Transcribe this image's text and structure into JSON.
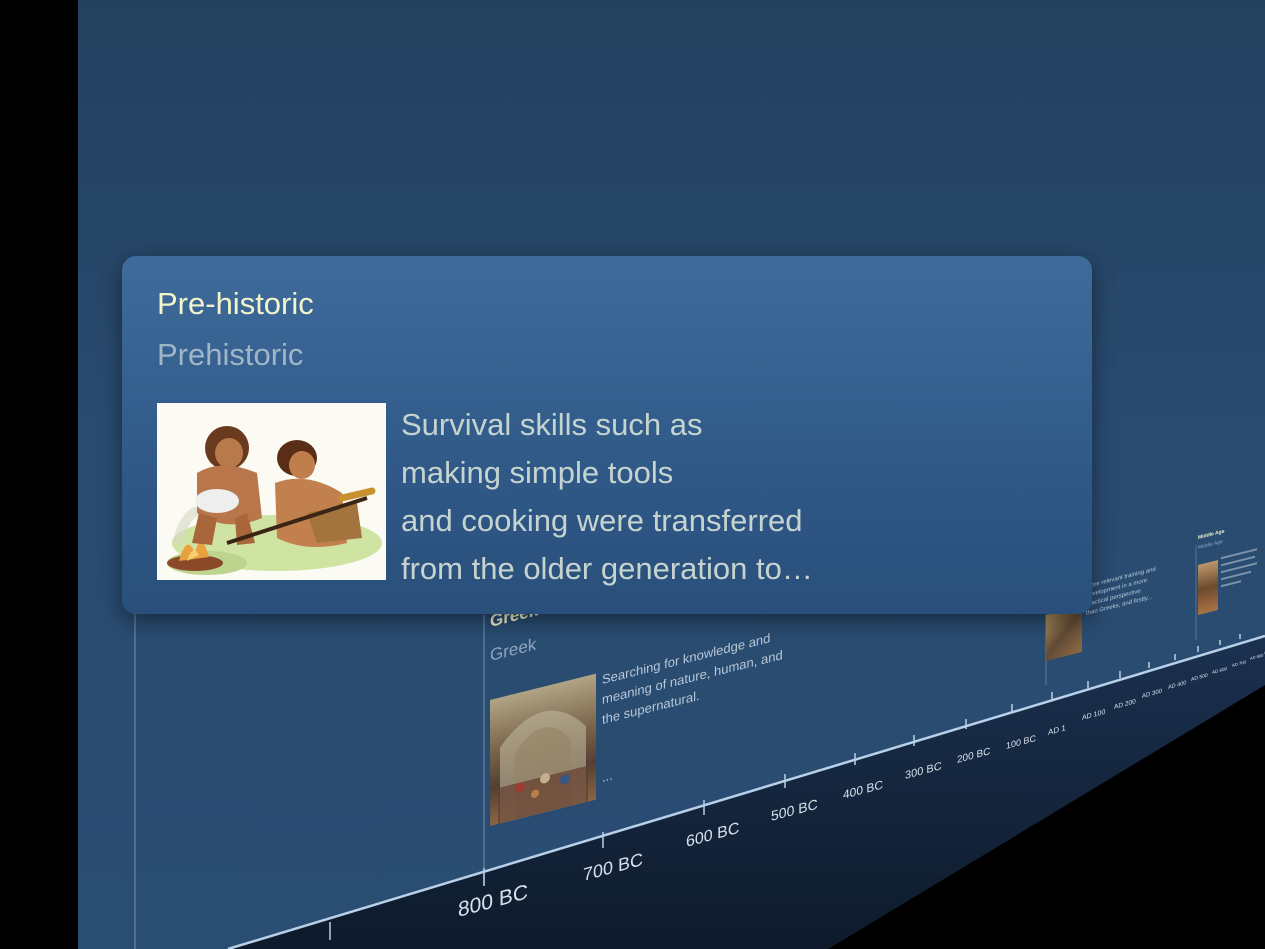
{
  "popup": {
    "title": "Pre-historic",
    "subtitle": "Prehistoric",
    "description_lines": [
      "Survival skills such as",
      "making simple tools",
      "and cooking were transferred",
      "from the older generation to…"
    ]
  },
  "greek_card": {
    "title": "Greek",
    "subtitle": "Greek",
    "description_lines": [
      "Searching for knowledge and",
      "meaning of nature, human, and",
      "the supernatural."
    ],
    "ellipsis": "..."
  },
  "roman_card": {
    "description_lines": [
      "more relevant training and",
      "development in a more",
      "practical perspective",
      "than Greeks, and firstly..."
    ]
  },
  "middle_age_card": {
    "title": "Middle Age",
    "subtitle": "Middle Age"
  },
  "timeline": {
    "labels": [
      "800 BC",
      "700 BC",
      "600 BC",
      "500 BC",
      "400 BC",
      "300 BC",
      "200 BC",
      "100 BC",
      "AD 1",
      "AD 100",
      "AD 200",
      "AD 300",
      "AD 400",
      "AD 500",
      "AD 600",
      "AD 700",
      "AD 800",
      "AD 900"
    ]
  },
  "colors": {
    "background": "#2a4d72",
    "popup_title": "#f2f5c9",
    "popup_subtitle": "#9fb6c7",
    "popup_text": "#c6d4cf",
    "timeline_line": "#a9c2dc"
  }
}
